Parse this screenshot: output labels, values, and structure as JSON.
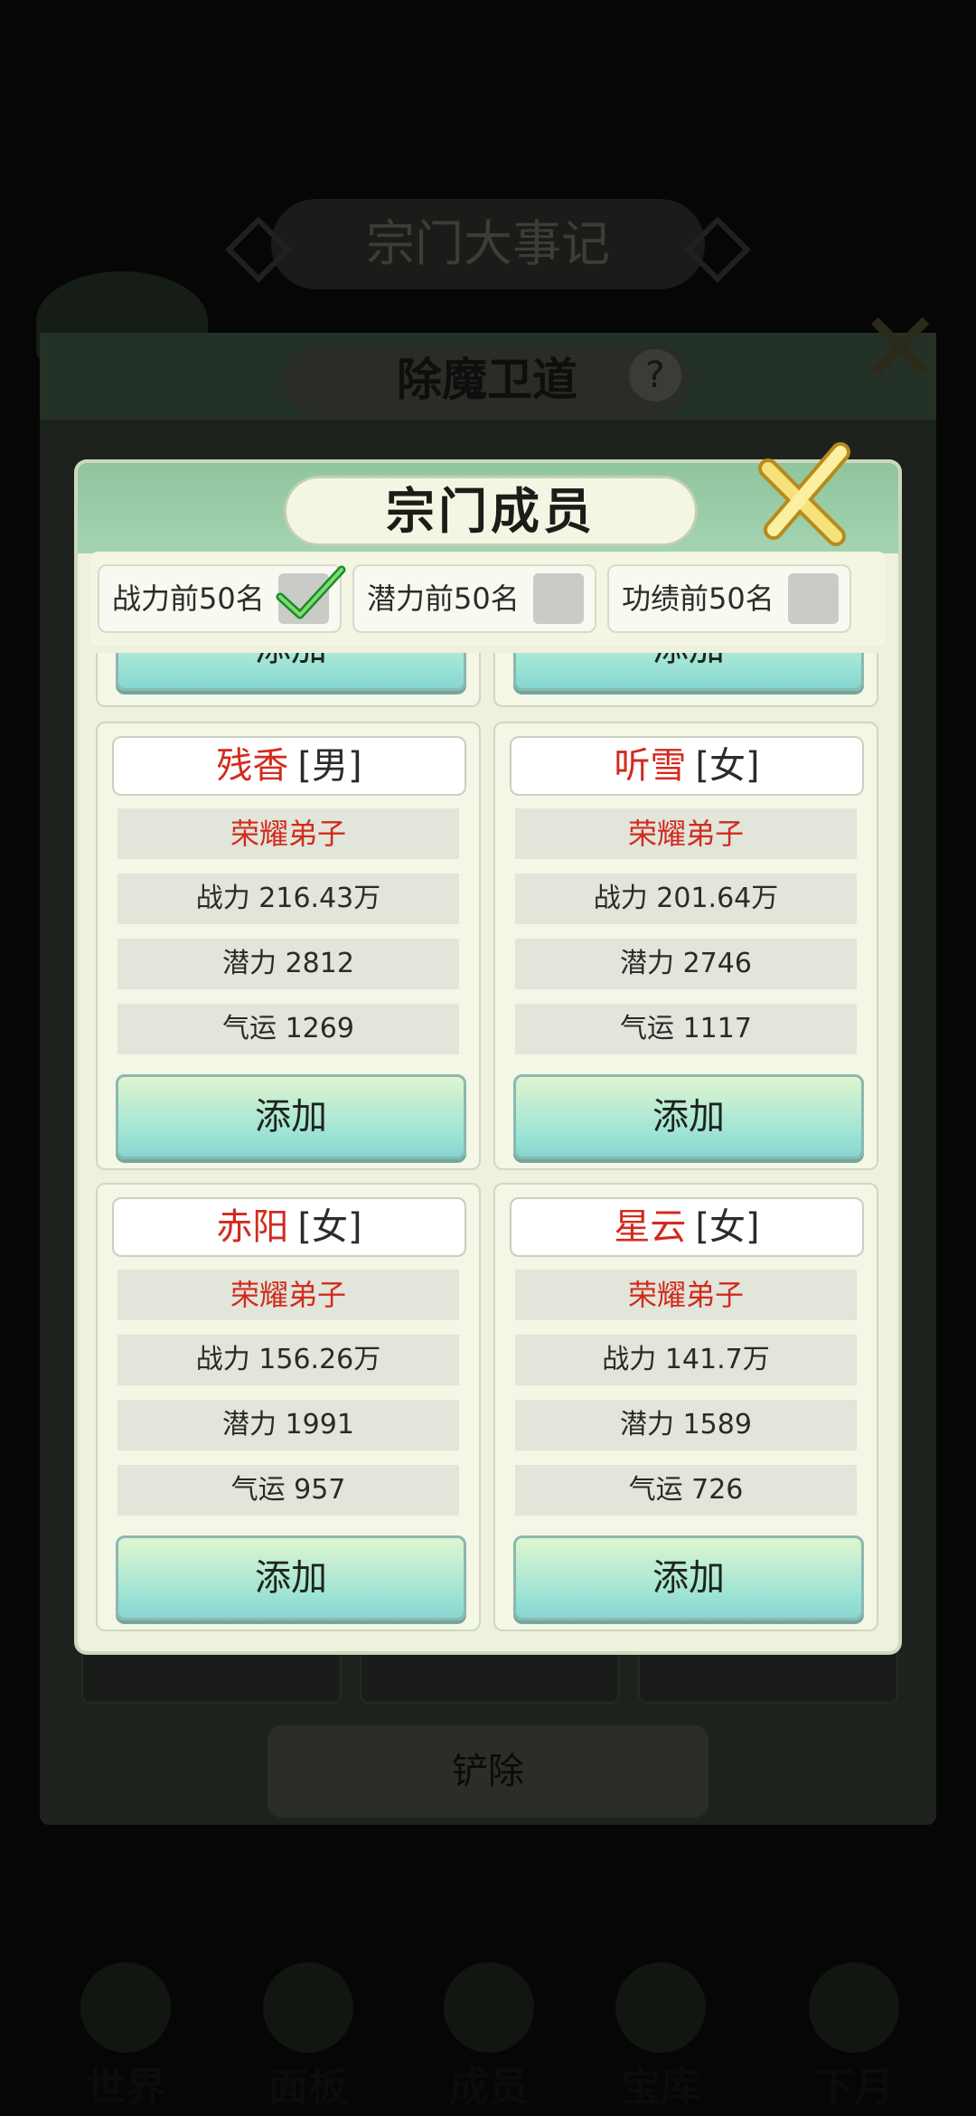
{
  "background": {
    "title": "宗门大事记",
    "panel_title": "除魔卫道",
    "help_glyph": "?",
    "remove_label": "铲除",
    "bottom_nav": [
      {
        "label": "世界"
      },
      {
        "label": "面板"
      },
      {
        "label": "成员"
      },
      {
        "label": "宝库"
      },
      {
        "label": "下月"
      }
    ]
  },
  "modal": {
    "title": "宗门成员",
    "close_icon": "close-x-icon",
    "filters": [
      {
        "label": "战力前50名",
        "checked": true
      },
      {
        "label": "潜力前50名",
        "checked": false
      },
      {
        "label": "功绩前50名",
        "checked": false
      }
    ],
    "add_label": "添加",
    "members": [
      {
        "name": "残香",
        "gender": "[男]",
        "rank": "荣耀弟子",
        "power": "战力 216.43万",
        "potential": "潜力 2812",
        "luck": "气运 1269"
      },
      {
        "name": "听雪",
        "gender": "[女]",
        "rank": "荣耀弟子",
        "power": "战力 201.64万",
        "potential": "潜力 2746",
        "luck": "气运 1117"
      },
      {
        "name": "赤阳",
        "gender": "[女]",
        "rank": "荣耀弟子",
        "power": "战力 156.26万",
        "potential": "潜力 1991",
        "luck": "气运 957"
      },
      {
        "name": "星云",
        "gender": "[女]",
        "rank": "荣耀弟子",
        "power": "战力 141.7万",
        "potential": "潜力 1589",
        "luck": "气运 726"
      }
    ]
  },
  "colors": {
    "accent_red": "#d12b1e",
    "header_green": "#8fc59e",
    "button_teal": "#9fe4d5"
  }
}
